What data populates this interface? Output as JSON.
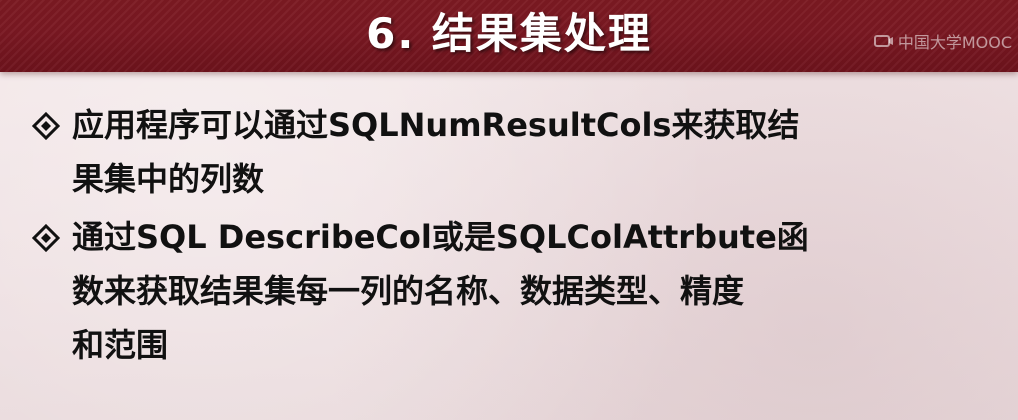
{
  "slide": {
    "title": "6. 结果集处理",
    "watermark": "中国大学MOOC",
    "colors": {
      "title_bar": "#7a1822",
      "title_text": "#ffffff",
      "body_background": "#f1e5e6",
      "body_text": "#111111"
    },
    "bullets": [
      {
        "icon": "diamond-bullet-icon",
        "lines": [
          "应用程序可以通过SQLNumResultCols来获取结",
          "果集中的列数"
        ]
      },
      {
        "icon": "diamond-bullet-icon",
        "lines": [
          "通过SQL DescribeCol或是SQLColAttrbute函",
          "数来获取结果集每一列的名称、数据类型、精度",
          "和范围"
        ]
      }
    ]
  }
}
